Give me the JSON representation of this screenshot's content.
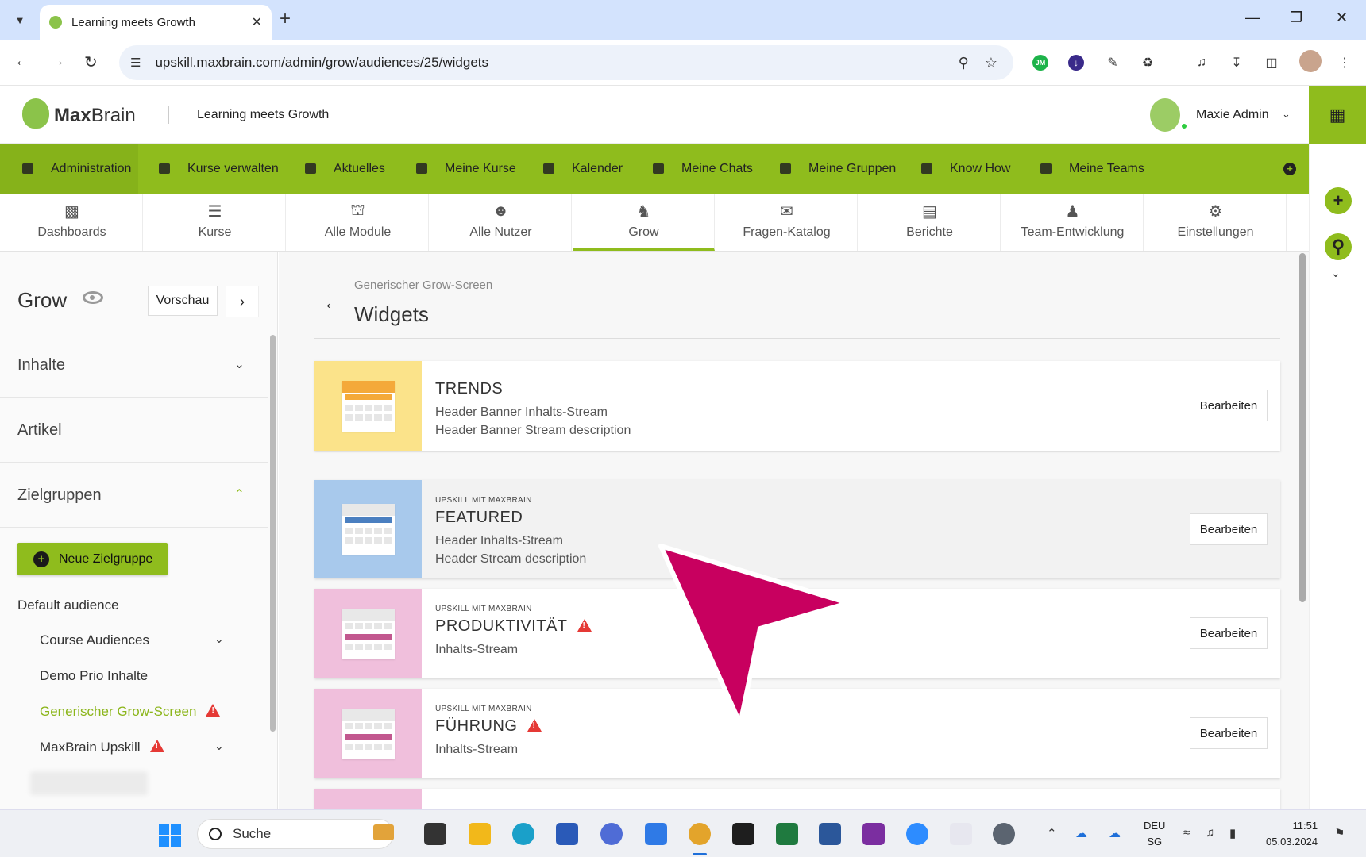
{
  "browser": {
    "tab_title": "Learning meets Growth",
    "url": "upskill.maxbrain.com/admin/grow/audiences/25/widgets"
  },
  "header": {
    "logo_max": "Max",
    "logo_brain": "Brain",
    "tagline": "Learning meets Growth",
    "user_name": "Maxie Admin"
  },
  "mainnav": [
    {
      "label": "Administration"
    },
    {
      "label": "Kurse verwalten"
    },
    {
      "label": "Aktuelles"
    },
    {
      "label": "Meine Kurse"
    },
    {
      "label": "Kalender"
    },
    {
      "label": "Meine Chats"
    },
    {
      "label": "Meine Gruppen"
    },
    {
      "label": "Know How"
    },
    {
      "label": "Meine Teams"
    }
  ],
  "admintabs": [
    {
      "label": "Dashboards",
      "icon": "dashboard-icon"
    },
    {
      "label": "Kurse",
      "icon": "courses-icon"
    },
    {
      "label": "Alle Module",
      "icon": "institution-icon"
    },
    {
      "label": "Alle Nutzer",
      "icon": "users-icon"
    },
    {
      "label": "Grow",
      "icon": "grow-icon"
    },
    {
      "label": "Fragen-Katalog",
      "icon": "questions-icon"
    },
    {
      "label": "Berichte",
      "icon": "report-icon"
    },
    {
      "label": "Team-Entwicklung",
      "icon": "team-icon"
    },
    {
      "label": "Einstellungen",
      "icon": "settings-icon"
    }
  ],
  "sidebar": {
    "title": "Grow",
    "preview": "Vorschau",
    "sections": [
      {
        "label": "Inhalte"
      },
      {
        "label": "Artikel"
      },
      {
        "label": "Zielgruppen"
      }
    ],
    "new_button": "Neue Zielgruppe",
    "heading": "Default audience",
    "items": [
      {
        "label": "Course Audiences"
      },
      {
        "label": "Demo Prio Inhalte"
      },
      {
        "label": "Generischer Grow-Screen"
      },
      {
        "label": "MaxBrain Upskill"
      }
    ]
  },
  "main": {
    "breadcrumb": "Generischer Grow-Screen",
    "title": "Widgets",
    "edit_label": "Bearbeiten",
    "cards": [
      {
        "overline": "",
        "title": "TRENDS",
        "lines": [
          "Header Banner Inhalts-Stream",
          "Header Banner Stream description"
        ],
        "thumb_bg": "#fbe38a",
        "accent": "#f4a93a"
      },
      {
        "overline": "UPSKILL MIT MAXBRAIN",
        "title": "FEATURED",
        "lines": [
          "Header Inhalts-Stream",
          "Header Stream description"
        ],
        "thumb_bg": "#a8c9ec",
        "accent": "#4a7fc0"
      },
      {
        "overline": "UPSKILL MIT MAXBRAIN",
        "title": "PRODUKTIVITÄT",
        "lines": [
          "Inhalts-Stream"
        ],
        "thumb_bg": "#f0bfdc",
        "accent": "#c2578f"
      },
      {
        "overline": "UPSKILL MIT MAXBRAIN",
        "title": "FÜHRUNG",
        "lines": [
          "Inhalts-Stream"
        ],
        "thumb_bg": "#f0bfdc",
        "accent": "#c2578f"
      }
    ]
  },
  "taskbar": {
    "search_label": "Suche",
    "lang_1": "DEU",
    "lang_2": "SG",
    "time": "11:51",
    "date": "05.03.2024"
  },
  "colors": {
    "brand_green": "#8fbc1d",
    "cursor_pink": "#c8005f",
    "warning_red": "#e53935"
  }
}
